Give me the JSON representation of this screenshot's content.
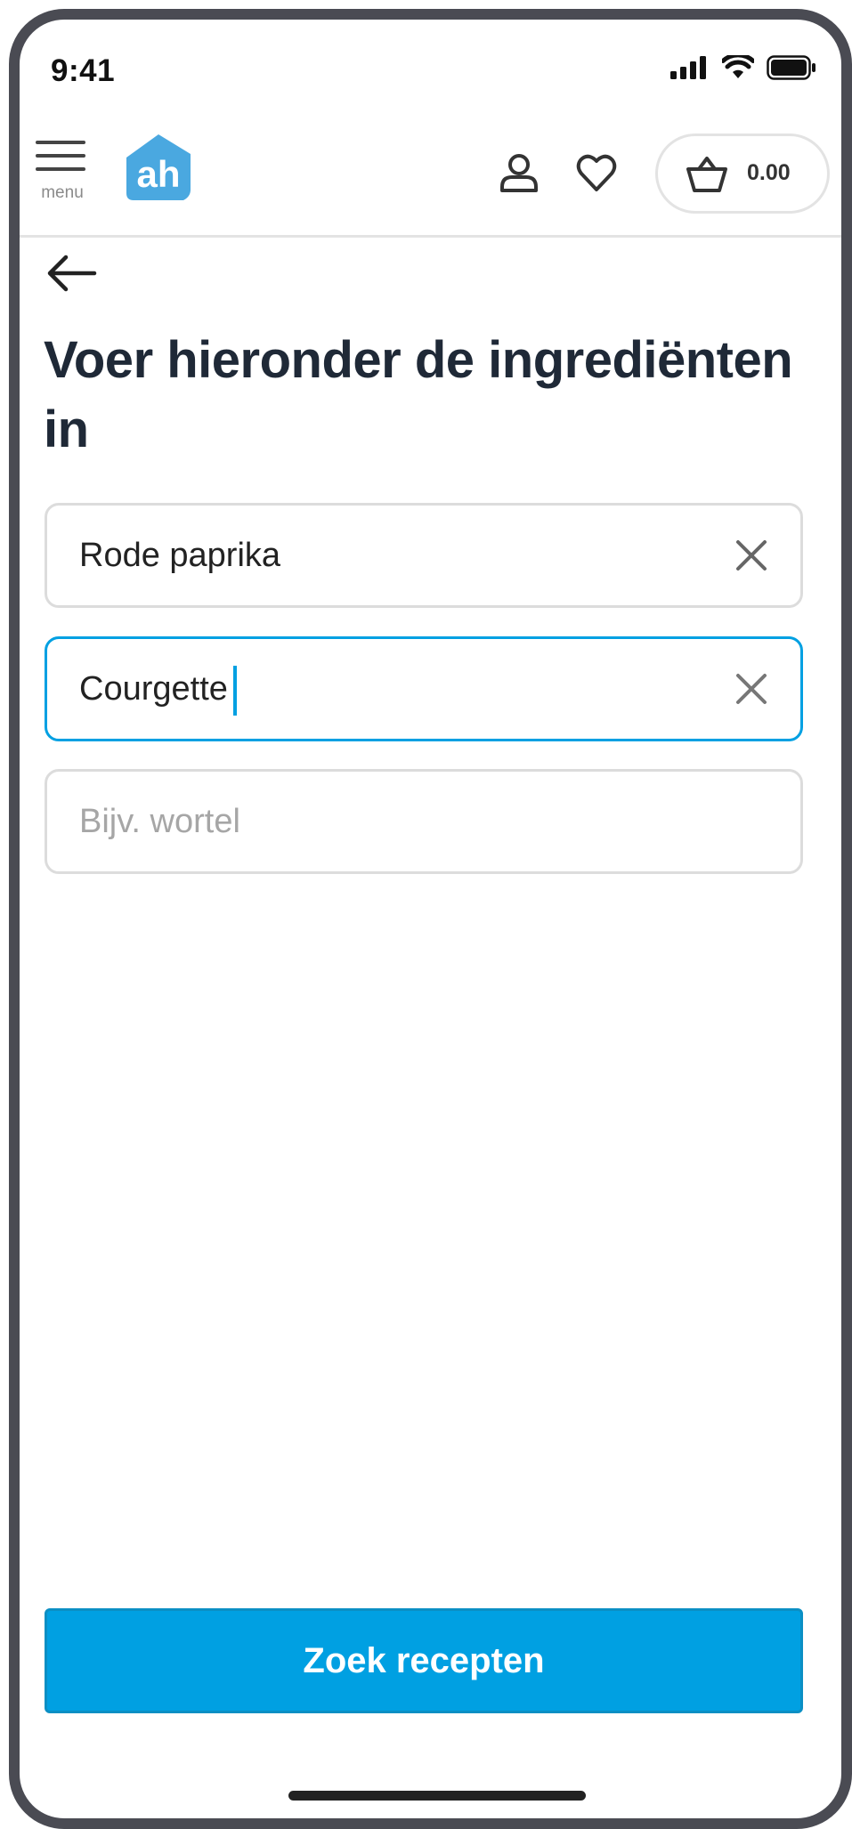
{
  "status_bar": {
    "time": "9:41"
  },
  "header": {
    "menu_label": "menu",
    "logo_text": "ah",
    "cart_total": "0.00"
  },
  "page": {
    "title": "Voer hieronder de ingrediënten in"
  },
  "ingredients": [
    {
      "value": "Rode paprika",
      "placeholder": ""
    },
    {
      "value": "Courgette",
      "placeholder": ""
    },
    {
      "value": "",
      "placeholder": "Bijv. wortel"
    }
  ],
  "actions": {
    "search_label": "Zoek recepten"
  },
  "colors": {
    "brand": "#00a0e2",
    "logo": "#4aa8e0",
    "title": "#1f2937",
    "border": "#dcdcdc"
  }
}
